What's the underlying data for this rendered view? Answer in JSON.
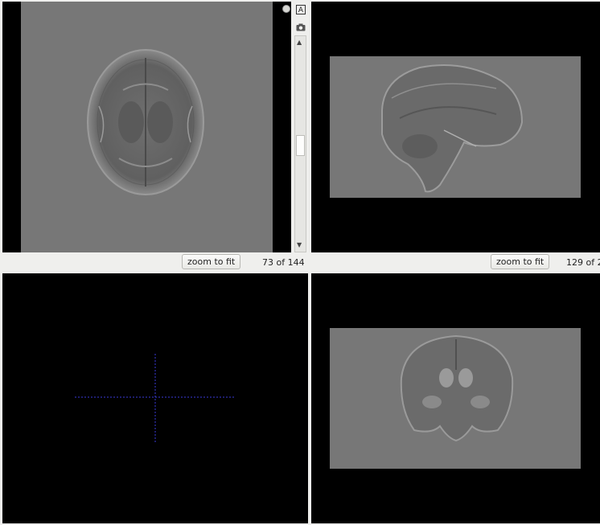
{
  "panels": {
    "axial": {
      "zoom_label": "zoom to fit",
      "slice_counter": "73 of 144"
    },
    "sagittal": {
      "zoom_label": "zoom to fit",
      "slice_counter": "129 of 2"
    },
    "coronal": {},
    "render3d": {}
  },
  "toolbar": {
    "annotation_label": "A",
    "icons": [
      "text-annotation-icon",
      "camera-icon",
      "scroll-up-arrow-icon",
      "scroll-down-arrow-icon",
      "dropdown-icon"
    ]
  },
  "colors": {
    "background": "#000000",
    "image_gray": "#777777",
    "crosshair": "#3a3ad8",
    "chrome": "#efefed"
  }
}
